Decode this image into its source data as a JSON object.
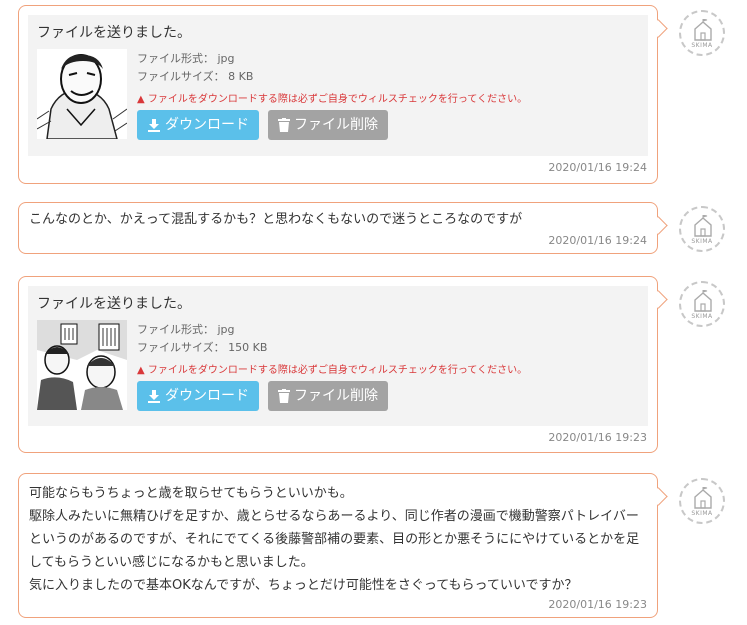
{
  "messages": [
    {
      "type": "file",
      "title": "ファイルを送りました。",
      "format_label": "ファイル形式： jpg",
      "size_label": "ファイルサイズ： 8 KB",
      "warning": "ファイルをダウンロードする際は必ずご自身でウィルスチェックを行ってください。",
      "download_label": "ダウンロード",
      "delete_label": "ファイル削除",
      "timestamp": "2020/01/16 19:24"
    },
    {
      "type": "text",
      "lines": [
        "こんなのとか、かえって混乱するかも？と思わなくもないので迷うところなのですが"
      ],
      "timestamp": "2020/01/16 19:24"
    },
    {
      "type": "file",
      "title": "ファイルを送りました。",
      "format_label": "ファイル形式： jpg",
      "size_label": "ファイルサイズ： 150 KB",
      "warning": "ファイルをダウンロードする際は必ずご自身でウィルスチェックを行ってください。",
      "download_label": "ダウンロード",
      "delete_label": "ファイル削除",
      "timestamp": "2020/01/16 19:23"
    },
    {
      "type": "text",
      "lines": [
        "可能ならもうちょっと歳を取らせてもらうといいかも。",
        "駆除人みたいに無精ひげを足すか、歳とらせるならあーるより、同じ作者の漫画で機動警察パトレイバー",
        "というのがあるのですが、それにでてくる後藤警部補の要素、目の形とか悪そうににやけているとかを足",
        "してもらうといい感じになるかもと思いました。",
        "気に入りましたので基本OKなんですが、ちょっとだけ可能性をさぐってもらっていいですか？"
      ],
      "timestamp": "2020/01/16 19:23"
    }
  ],
  "avatar": {
    "label": "SKIMA",
    "icon": "house-flag-icon"
  },
  "colors": {
    "border": "#f0a27c",
    "download": "#5bc0ea",
    "delete": "#a3a3a3",
    "warning": "#d9383a"
  }
}
